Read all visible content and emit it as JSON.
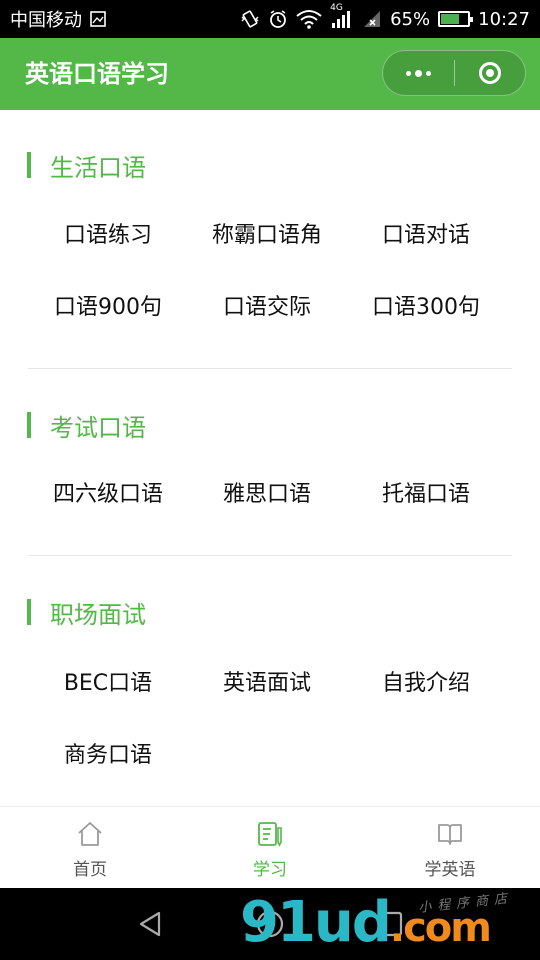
{
  "status_bar": {
    "carrier": "中国移动",
    "network_type": "4G",
    "battery_percent": "65%",
    "time": "10:27"
  },
  "title_bar": {
    "title": "英语口语学习",
    "more_icon": "more-dots-icon",
    "close_icon": "target-circle-icon"
  },
  "sections": [
    {
      "title": "生活口语",
      "items": [
        "口语练习",
        "称霸口语角",
        "口语对话",
        "口语900句",
        "口语交际",
        "口语300句"
      ]
    },
    {
      "title": "考试口语",
      "items": [
        "四六级口语",
        "雅思口语",
        "托福口语"
      ]
    },
    {
      "title": "职场面试",
      "items": [
        "BEC口语",
        "英语面试",
        "自我介绍",
        "商务口语"
      ]
    }
  ],
  "tab_bar": {
    "active_index": 1,
    "accent_color": "#53b848",
    "tabs": [
      {
        "label": "首页",
        "icon": "home-icon"
      },
      {
        "label": "学习",
        "icon": "notebook-pen-icon"
      },
      {
        "label": "学英语",
        "icon": "open-book-icon"
      }
    ]
  },
  "nav_bar": {
    "buttons": [
      "back-triangle-icon",
      "home-circle-icon",
      "recents-square-icon"
    ]
  },
  "watermark": {
    "logo_main": "91ud",
    "logo_suffix": ".com",
    "tagline": "小程序商店"
  },
  "colors": {
    "brand_green": "#53b848",
    "status_bar_bg": "#000000",
    "text": "#111111"
  }
}
